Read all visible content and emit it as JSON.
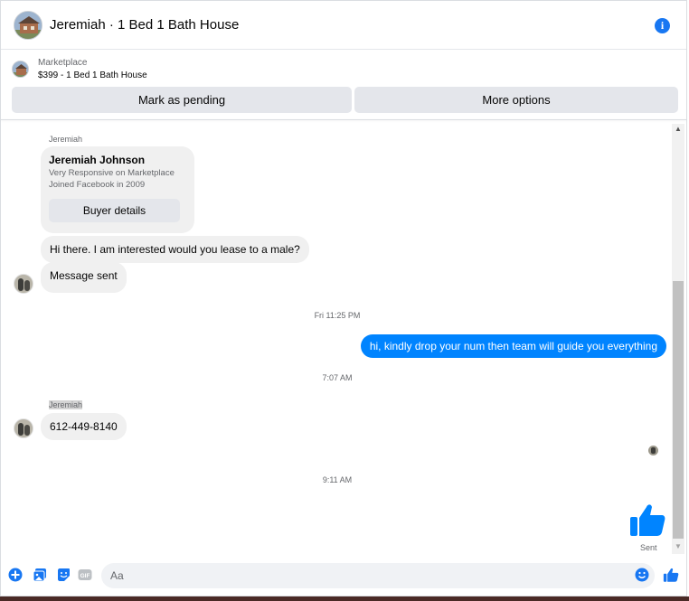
{
  "header": {
    "title": "Jeremiah · 1 Bed 1 Bath House"
  },
  "listing": {
    "label": "Marketplace",
    "description": "$399 - 1 Bed 1 Bath House"
  },
  "actions": {
    "pending": "Mark as pending",
    "more": "More options"
  },
  "buyer_card": {
    "sender": "Jeremiah",
    "name": "Jeremiah Johnson",
    "line1": "Very Responsive on Marketplace",
    "line2": "Joined Facebook in 2009",
    "button": "Buyer details"
  },
  "messages": {
    "m1": "Hi there.  I am interested would you lease to a male?",
    "m2": "Message sent",
    "t1": "Fri 11:25 PM",
    "m3": "hi, kindly drop your num then team will guide you everything",
    "t2": "7:07 AM",
    "sender2": "Jeremiah",
    "m4": "612-449-8140",
    "t3": "9:11 AM",
    "sent": "Sent"
  },
  "composer": {
    "placeholder": "Aa"
  },
  "colors": {
    "accent": "#1877f2",
    "outgoing": "#0084ff",
    "bubble_in": "#f0f0f0"
  }
}
